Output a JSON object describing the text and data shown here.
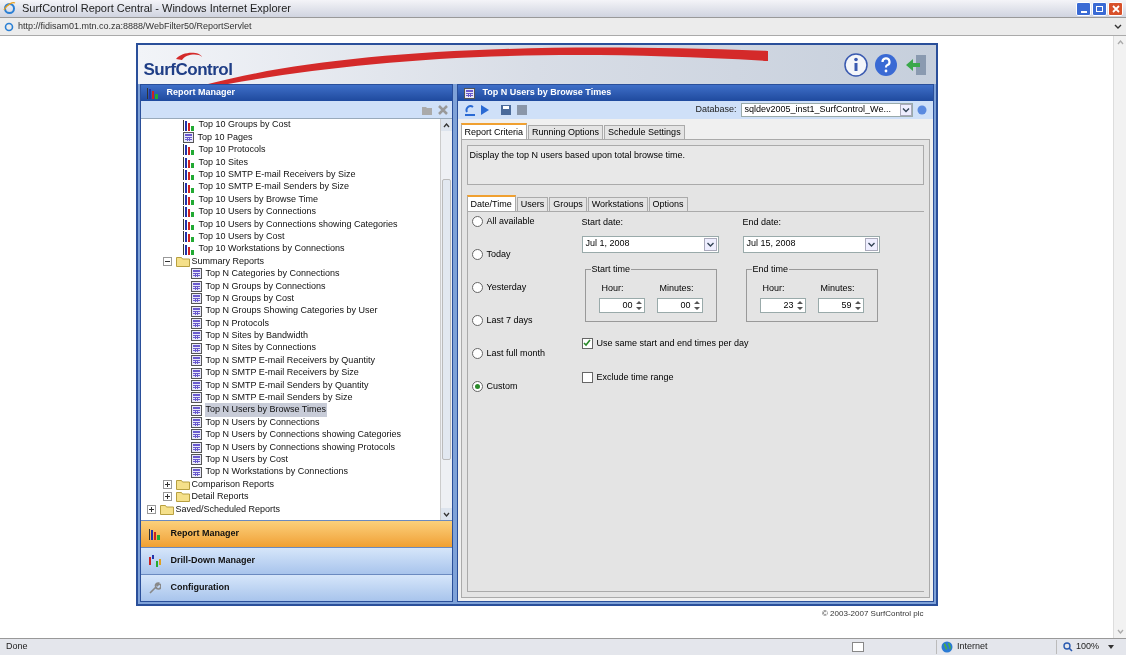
{
  "browser": {
    "title": "SurfControl Report Central - Windows Internet Explorer",
    "address": "http://fidisam01.mtn.co.za:8888/WebFilter50/ReportServlet"
  },
  "app": {
    "logo": "SurfControl",
    "copyright": "© 2003-2007 SurfControl plc"
  },
  "left_panel": {
    "title": "Report Manager",
    "tree": [
      {
        "kind": "hidden",
        "children": [
          {
            "kind": "hidden",
            "children": [
              {
                "kind": "chart",
                "label": "Top 10 Groups by Cost",
                "selected": false
              },
              {
                "kind": "table",
                "label": "Top 10 Pages",
                "selected": false
              },
              {
                "kind": "chart",
                "label": "Top 10 Protocols",
                "selected": false
              },
              {
                "kind": "chart",
                "label": "Top 10 Sites",
                "selected": false
              },
              {
                "kind": "chart",
                "label": "Top 10 SMTP E-mail Receivers by Size",
                "selected": false
              },
              {
                "kind": "chart",
                "label": "Top 10 SMTP E-mail Senders by Size",
                "selected": false
              },
              {
                "kind": "chart",
                "label": "Top 10 Users by Browse Time",
                "selected": false
              },
              {
                "kind": "chart",
                "label": "Top 10 Users by Connections",
                "selected": false
              },
              {
                "kind": "chart",
                "label": "Top 10 Users by Connections showing Categories",
                "selected": false
              },
              {
                "kind": "chart",
                "label": "Top 10 Users by Cost",
                "selected": false
              },
              {
                "kind": "chart",
                "label": "Top 10 Workstations by Connections",
                "selected": false
              }
            ]
          },
          {
            "kind": "folder",
            "label": "Summary Reports",
            "expanded": true,
            "children": [
              {
                "kind": "table",
                "label": "Top N Categories by Connections",
                "selected": false
              },
              {
                "kind": "table",
                "label": "Top N Groups by Connections",
                "selected": false
              },
              {
                "kind": "table",
                "label": "Top N Groups by Cost",
                "selected": false
              },
              {
                "kind": "table",
                "label": "Top N Groups Showing Categories by User",
                "selected": false
              },
              {
                "kind": "table",
                "label": "Top N Protocols",
                "selected": false
              },
              {
                "kind": "table",
                "label": "Top N Sites by Bandwidth",
                "selected": false
              },
              {
                "kind": "table",
                "label": "Top N Sites by Connections",
                "selected": false
              },
              {
                "kind": "table",
                "label": "Top N SMTP E-mail Receivers by Quantity",
                "selected": false
              },
              {
                "kind": "table",
                "label": "Top N SMTP E-mail Receivers by Size",
                "selected": false
              },
              {
                "kind": "table",
                "label": "Top N SMTP E-mail Senders by Quantity",
                "selected": false
              },
              {
                "kind": "table",
                "label": "Top N SMTP E-mail Senders by Size",
                "selected": false
              },
              {
                "kind": "table",
                "label": "Top N Users by Browse Times",
                "selected": true
              },
              {
                "kind": "table",
                "label": "Top N Users by Connections",
                "selected": false
              },
              {
                "kind": "table",
                "label": "Top N Users by Connections showing Categories",
                "selected": false
              },
              {
                "kind": "table",
                "label": "Top N Users by Connections showing Protocols",
                "selected": false
              },
              {
                "kind": "table",
                "label": "Top N Users by Cost",
                "selected": false
              },
              {
                "kind": "table",
                "label": "Top N Workstations by Connections",
                "selected": false
              }
            ]
          },
          {
            "kind": "folder",
            "label": "Comparison Reports",
            "expanded": false
          },
          {
            "kind": "folder",
            "label": "Detail Reports",
            "expanded": false
          }
        ]
      },
      {
        "kind": "folder",
        "label": "Saved/Scheduled Reports",
        "expanded": false
      }
    ],
    "nav": [
      {
        "kind": "report",
        "label": "Report Manager",
        "selected": true
      },
      {
        "kind": "drill",
        "label": "Drill-Down Manager",
        "selected": false
      },
      {
        "kind": "config",
        "label": "Configuration",
        "selected": false
      }
    ]
  },
  "right_panel": {
    "title": "Top N Users by Browse Times",
    "database_label": "Database:",
    "database": "sqldev2005_inst1_SurfControl_We...",
    "tabs": [
      {
        "label": "Report Criteria",
        "selected": true
      },
      {
        "label": "Running Options",
        "selected": false
      },
      {
        "label": "Schedule Settings",
        "selected": false
      }
    ],
    "description": "Display the top N users based upon total browse time.",
    "subtabs": [
      {
        "label": "Date/Time",
        "selected": true
      },
      {
        "label": "Users",
        "selected": false
      },
      {
        "label": "Groups",
        "selected": false
      },
      {
        "label": "Workstations",
        "selected": false
      },
      {
        "label": "Options",
        "selected": false
      }
    ],
    "ranges": [
      {
        "label": "All available",
        "selected": false
      },
      {
        "label": "Today",
        "selected": false
      },
      {
        "label": "Yesterday",
        "selected": false
      },
      {
        "label": "Last 7 days",
        "selected": false
      },
      {
        "label": "Last full month",
        "selected": false
      },
      {
        "label": "Custom",
        "selected": true
      }
    ],
    "start_date": {
      "label": "Start date:",
      "value": "Jul 1, 2008"
    },
    "end_date": {
      "label": "End date:",
      "value": "Jul 15, 2008"
    },
    "start_time": {
      "title": "Start time",
      "hour_label": "Hour:",
      "hour": "00",
      "minutes_label": "Minutes:",
      "minutes": "00"
    },
    "end_time": {
      "title": "End time",
      "hour_label": "Hour:",
      "hour": "23",
      "minutes_label": "Minutes:",
      "minutes": "59"
    },
    "checkboxes": [
      {
        "label": "Use same start and end times per day",
        "checked": true
      },
      {
        "label": "Exclude time range",
        "checked": false
      }
    ]
  },
  "status_bar": {
    "status": "Done",
    "zone": "Internet",
    "zoom": "100%"
  }
}
